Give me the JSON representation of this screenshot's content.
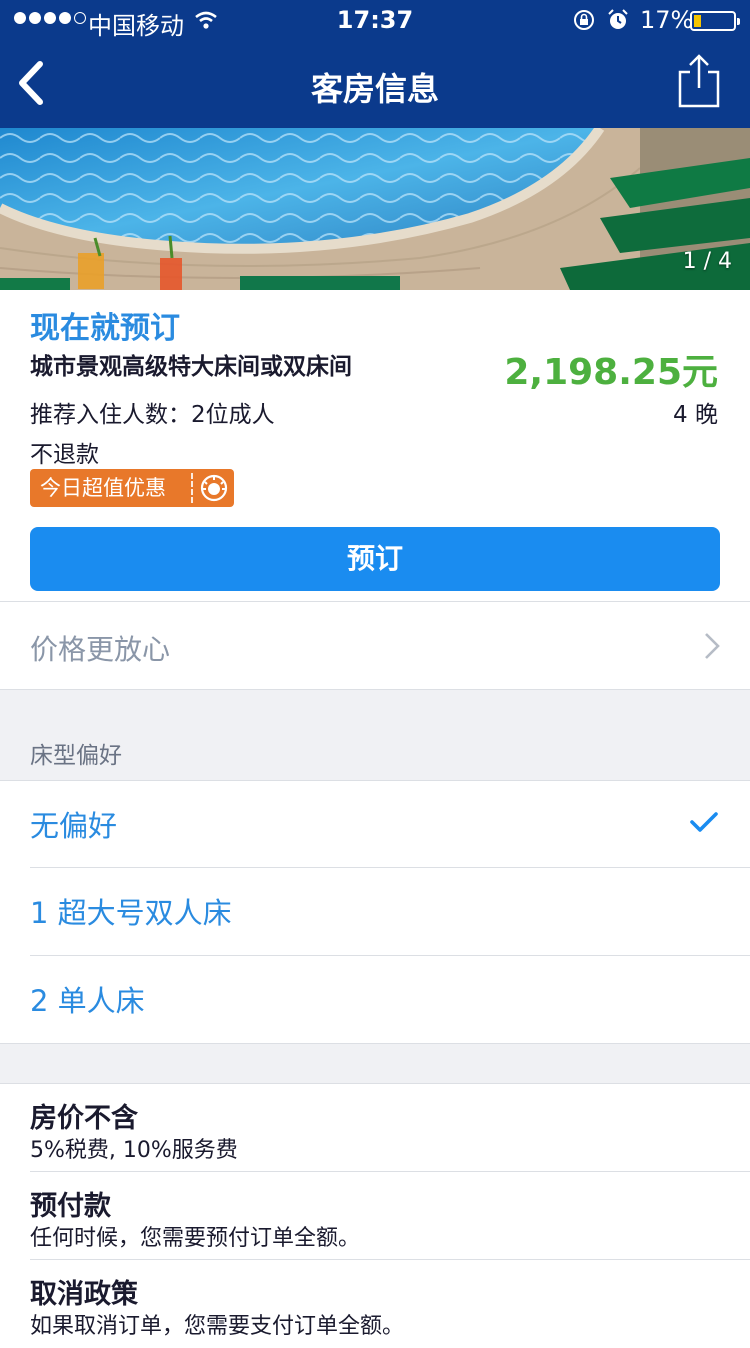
{
  "status_bar": {
    "carrier": "中国移动",
    "time": "17:37",
    "battery": "17%"
  },
  "nav": {
    "title": "客房信息",
    "back_icon": "chevron-left-icon",
    "share_icon": "share-icon"
  },
  "hero": {
    "counter": "1 / 4"
  },
  "booking": {
    "book_now": "现在就预订",
    "room_name": "城市景观高级特大床间或双床间",
    "price": "2,198.25元",
    "occupancy": "推荐入住人数：2位成人",
    "nights": "4 晚",
    "refund": "不退款",
    "deal_badge": "今日超值优惠",
    "book_button": "预订"
  },
  "peace_of_mind": {
    "label": "价格更放心"
  },
  "bed_preference": {
    "header": "床型偏好",
    "options": [
      {
        "label": "无偏好",
        "selected": true
      },
      {
        "label": "1 超大号双人床",
        "selected": false
      },
      {
        "label": "2 单人床",
        "selected": false
      }
    ]
  },
  "policies": [
    {
      "title": "房价不含",
      "text": "5%税费, 10%服务费"
    },
    {
      "title": "预付款",
      "text": "任何时候，您需要预付订单全额。"
    },
    {
      "title": "取消政策",
      "text": "如果取消订单，您需要支付订单全额。"
    }
  ],
  "colors": {
    "nav_bg": "#0b3a8c",
    "accent_blue": "#2a8be0",
    "button_blue": "#1a8cf0",
    "price_green": "#4db03f",
    "deal_orange": "#e8782a"
  }
}
